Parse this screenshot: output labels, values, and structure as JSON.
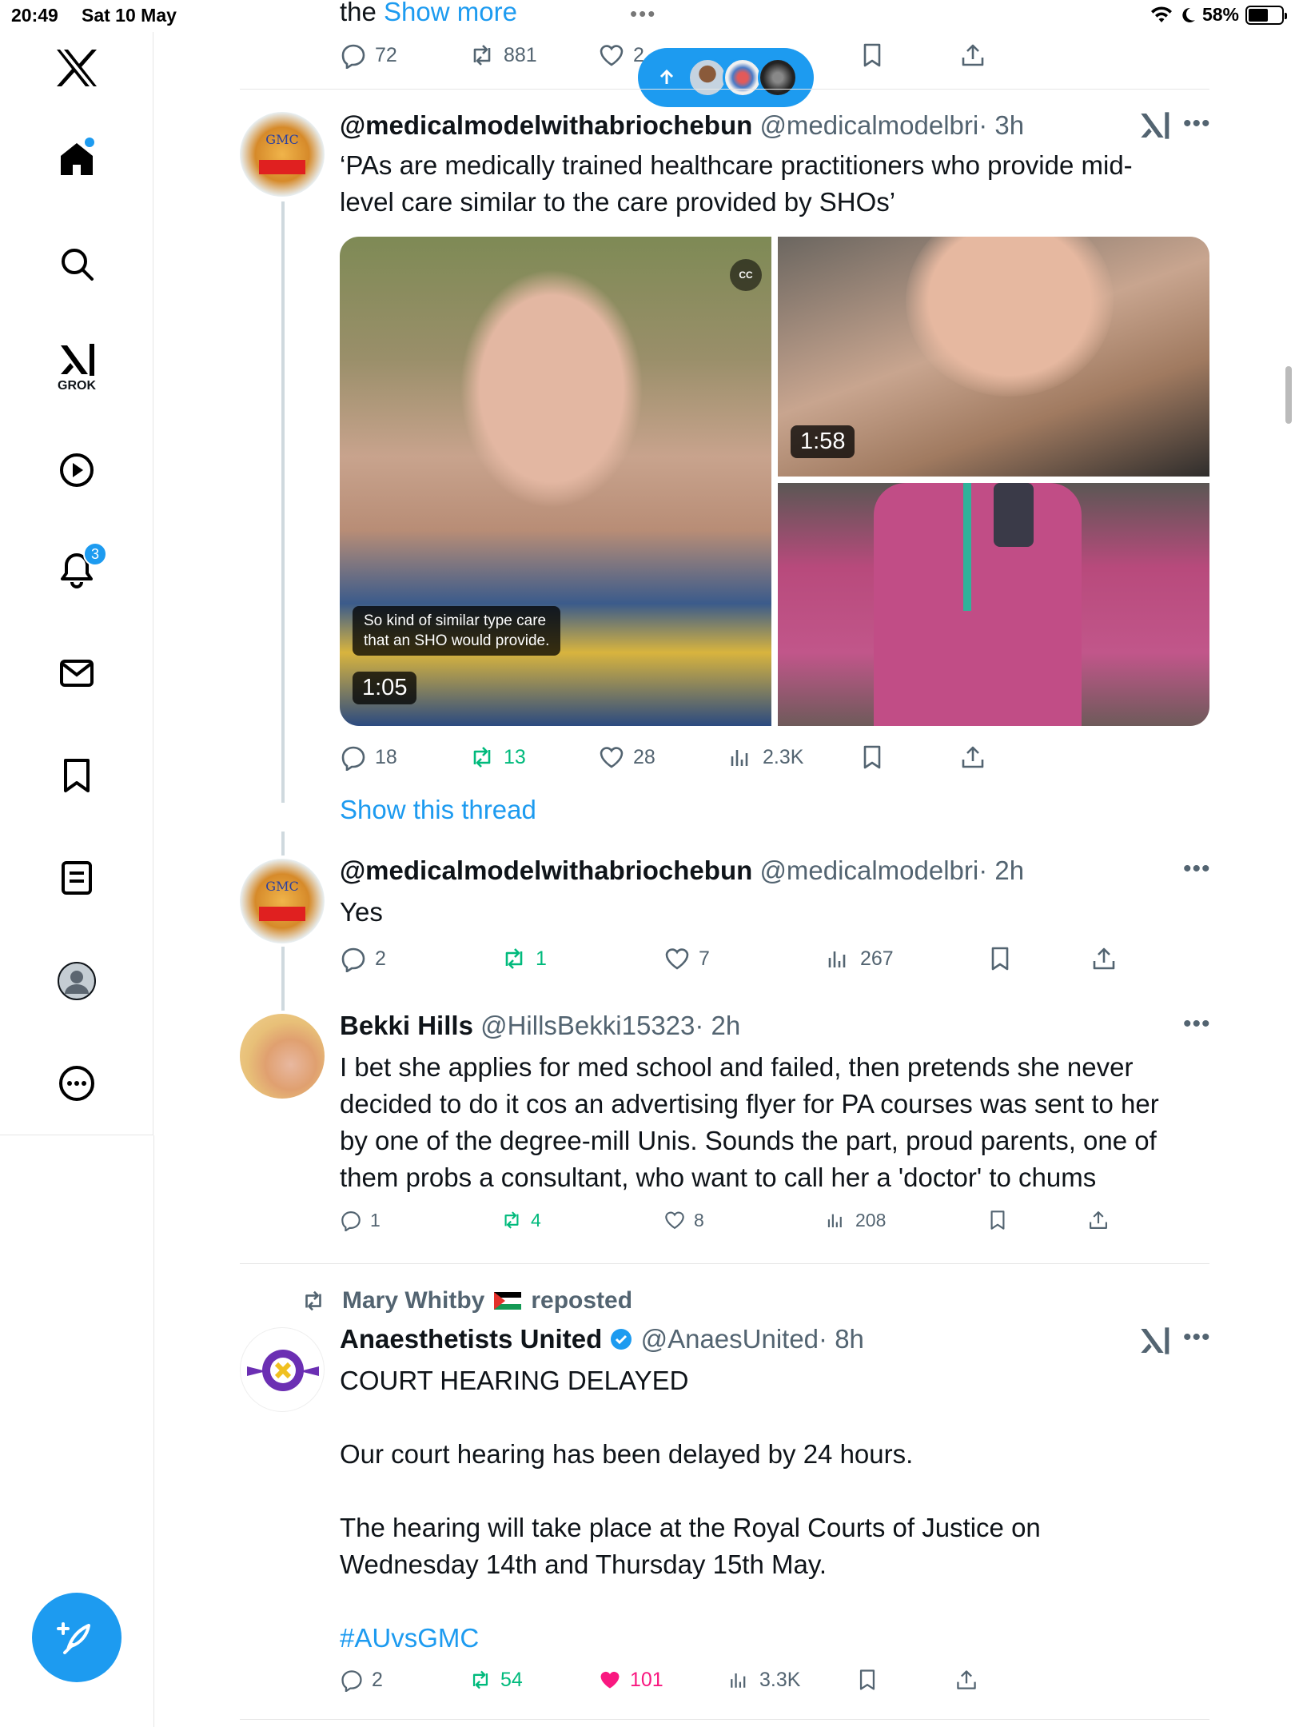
{
  "status_bar": {
    "time": "20:49",
    "date": "Sat 10 May",
    "battery": "58%"
  },
  "sidebar": {
    "grok_label": "GROK",
    "notifications_count": "3"
  },
  "top_tweet": {
    "show_more_prefix": "the",
    "show_more": "Show more",
    "replies": "72",
    "reposts": "881",
    "likes": "2"
  },
  "tweet1": {
    "name": "@medicalmodelwithabriochebun",
    "handle": "@medicalmodelbri",
    "time": "· 3h",
    "text_line1": "‘PAs are medically trained healthcare practitioners who provide mid-",
    "text_line2": "level care similar to the care provided by SHOs’",
    "caption_line1": "So kind of similar type care",
    "caption_line2": "that an SHO would provide.",
    "video1_duration": "1:05",
    "video2_duration": "1:58",
    "cc": "CC",
    "replies": "18",
    "reposts": "13",
    "likes": "28",
    "views": "2.3K",
    "show_thread": "Show this thread"
  },
  "tweet2": {
    "name": "@medicalmodelwithabriochebun",
    "handle": "@medicalmodelbri",
    "time": "· 2h",
    "text": "Yes",
    "replies": "2",
    "reposts": "1",
    "likes": "7",
    "views": "267"
  },
  "tweet3": {
    "name": "Bekki Hills",
    "handle": "@HillsBekki15323",
    "time": "· 2h",
    "line1": "I bet she applies for med school and failed, then pretends she never",
    "line2": "decided to do it cos an advertising flyer for PA courses was sent to her",
    "line3": "by one of the degree-mill Unis. Sounds the part, proud parents, one of",
    "line4": "them probs a consultant, who want to call her a 'doctor' to chums",
    "replies": "1",
    "reposts": "4",
    "likes": "8",
    "views": "208"
  },
  "tweet4": {
    "reposted_by": "Mary Whitby",
    "reposted_label": "reposted",
    "name": "Anaesthetists United",
    "handle": "@AnaesUnited",
    "time": "· 8h",
    "p1": "COURT HEARING DELAYED",
    "p2": "Our court hearing has been delayed by 24 hours.",
    "p3_line1": "The hearing will take place  at the Royal Courts of Justice on",
    "p3_line2": "Wednesday 14th and Thursday  15th May.",
    "hashtag": "#AUvsGMC",
    "replies": "2",
    "reposts": "54",
    "likes": "101",
    "views": "3.3K"
  },
  "colors": {
    "accent": "#1d9bf0",
    "repost_green": "#00ba7c",
    "like_pink": "#f91880",
    "muted": "#536471"
  }
}
